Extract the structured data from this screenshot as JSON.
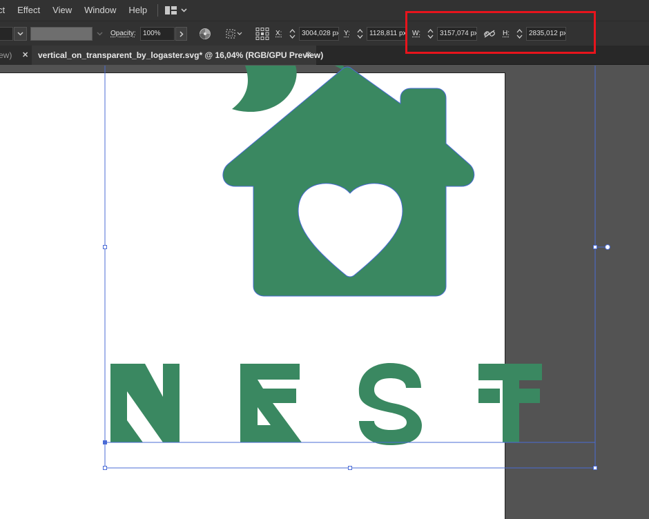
{
  "menubar": {
    "items": [
      "ct",
      "Effect",
      "View",
      "Window",
      "Help"
    ],
    "workspace_icon": "workspace-layout-icon",
    "workspace_chevron": "chevron-down-icon"
  },
  "controlbar": {
    "opacity_label": "Opacity:",
    "opacity_value": "100%",
    "x_label": "X:",
    "x_value": "3004,028 px",
    "y_label": "Y:",
    "y_value": "1128,811 px",
    "w_label": "W:",
    "w_value": "3157,074 px",
    "h_label": "H:",
    "h_value": "2835,012 px",
    "link_icon": "unlink-proportions-icon"
  },
  "tabs": [
    {
      "label": "ew)",
      "active": false
    },
    {
      "label": "vertical_on_transparent_by_logaster.svg* @ 16,04% (RGB/GPU Preview)",
      "active": true
    }
  ],
  "artwork": {
    "letters": [
      "N",
      "E",
      "S",
      "F"
    ],
    "logo_color": "#3a8861",
    "selection_color": "#4a6bd6"
  },
  "highlight_color": "#e8141c"
}
